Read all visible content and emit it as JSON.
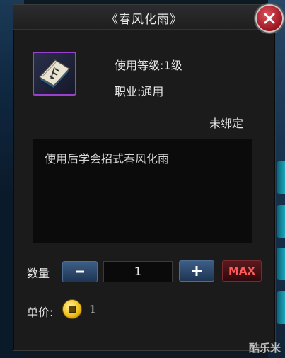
{
  "dialog": {
    "title": "《春风化雨》",
    "close_icon": "close-icon"
  },
  "item": {
    "icon": "skill-book-icon",
    "level_requirement": "使用等级:1级",
    "profession": "职业:通用",
    "bind_status": "未绑定",
    "description": "使用后学会招式春风化雨"
  },
  "purchase": {
    "quantity_label": "数量",
    "quantity_value": "1",
    "decrease_icon": "minus-icon",
    "increase_icon": "plus-icon",
    "max_label": "MAX",
    "unit_price_label": "单价:",
    "unit_price_value": "1",
    "currency_icon": "coin-icon"
  },
  "watermark": "酷乐米",
  "colors": {
    "panel_bg": "#1b1b1c",
    "description_bg": "#0b0b0b",
    "item_border": "#9b3fcf",
    "button_blue": "#3d5e86",
    "max_text": "#ff5a5a",
    "close_red": "#b51d28"
  }
}
